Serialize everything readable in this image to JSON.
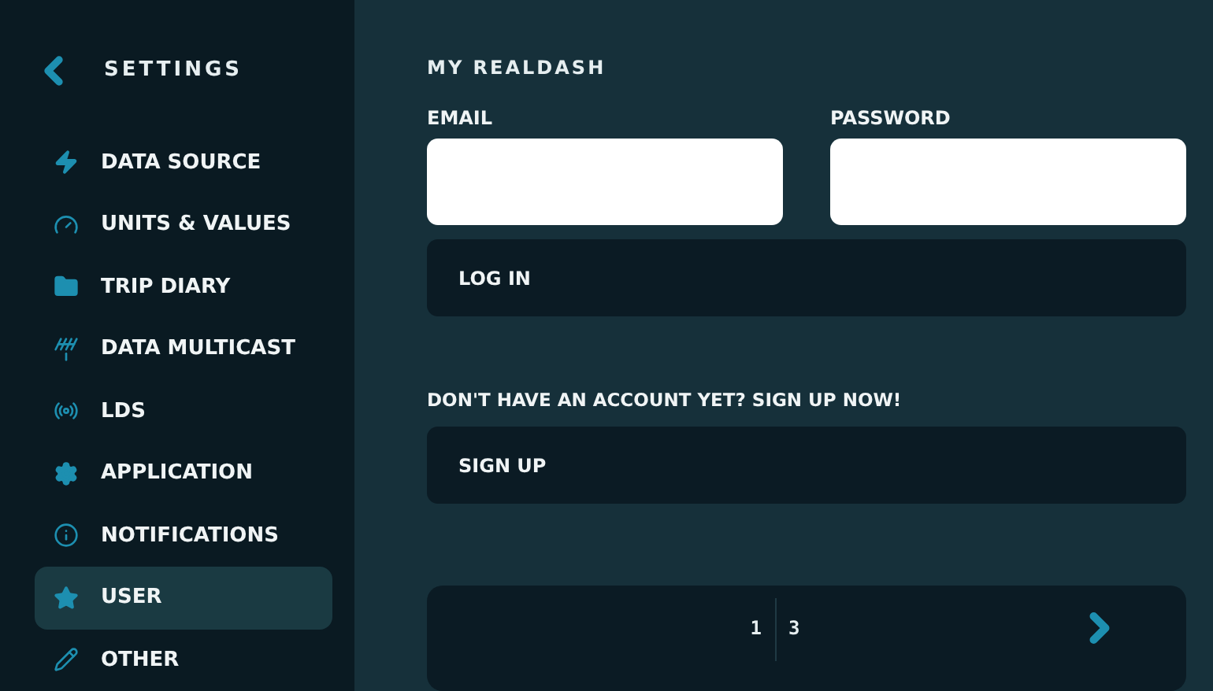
{
  "sidebar": {
    "title": "SETTINGS",
    "items": [
      {
        "label": "DATA SOURCE",
        "selected": false
      },
      {
        "label": "UNITS & VALUES",
        "selected": false
      },
      {
        "label": "TRIP DIARY",
        "selected": false
      },
      {
        "label": "DATA MULTICAST",
        "selected": false
      },
      {
        "label": "LDS",
        "selected": false
      },
      {
        "label": "APPLICATION",
        "selected": false
      },
      {
        "label": "NOTIFICATIONS",
        "selected": false
      },
      {
        "label": "USER",
        "selected": true
      },
      {
        "label": "OTHER",
        "selected": false
      }
    ]
  },
  "main": {
    "title": "MY REALDASH",
    "email": {
      "label": "EMAIL"
    },
    "password": {
      "label": "PASSWORD"
    },
    "login_button": "LOG IN",
    "signup_prompt": "DON'T HAVE AN ACCOUNT YET? SIGN UP NOW!",
    "signup_button": "SIGN UP",
    "pager": {
      "current": "1",
      "total": "3"
    }
  }
}
